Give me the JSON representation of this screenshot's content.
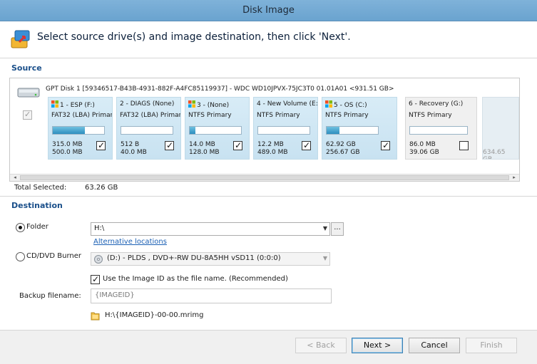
{
  "window": {
    "title": "Disk Image"
  },
  "header": {
    "instruction": "Select source drive(s) and image destination, then click 'Next'."
  },
  "source": {
    "section_label": "Source",
    "disk_info": "GPT Disk 1 [59346517-B43B-4931-882F-A4FC85119937] - WDC WD10JPVX-75JC3T0 01.01A01  <931.51 GB>",
    "partitions": [
      {
        "title": "1 - ESP (F:)",
        "fs": "FAT32 (LBA) Primary",
        "used": "315.0 MB",
        "total": "500.0 MB",
        "fill": 0.63,
        "checked": true,
        "windows_flag": true,
        "style": "selected"
      },
      {
        "title": "2 - DIAGS (None)",
        "fs": "FAT32 (LBA) Primary",
        "used": "512 B",
        "total": "40.0 MB",
        "fill": 0.0,
        "checked": true,
        "windows_flag": false,
        "style": "selected"
      },
      {
        "title": "3 - (None)",
        "fs": "NTFS Primary",
        "used": "14.0 MB",
        "total": "128.0 MB",
        "fill": 0.11,
        "checked": true,
        "windows_flag": true,
        "style": "selected"
      },
      {
        "title": "4 - New Volume (E:)",
        "fs": "NTFS Primary",
        "used": "12.2 MB",
        "total": "489.0 MB",
        "fill": 0.0,
        "checked": true,
        "windows_flag": false,
        "style": "selected"
      },
      {
        "title": "5 - OS (C:)",
        "fs": "NTFS Primary",
        "used": "62.92 GB",
        "total": "256.67 GB",
        "fill": 0.25,
        "checked": true,
        "windows_flag": true,
        "style": "selected"
      },
      {
        "title": "6 - Recovery (G:)",
        "fs": "NTFS Primary",
        "used": "86.0 MB",
        "total": "39.06 GB",
        "fill": 0.0,
        "checked": false,
        "windows_flag": false,
        "style": "plain"
      }
    ],
    "unallocated_size": "634.65 GB",
    "total_selected_label": "Total Selected:",
    "total_selected_value": "63.26 GB"
  },
  "destination": {
    "section_label": "Destination",
    "folder_label": "Folder",
    "folder_value": "H:\\",
    "browse_label": "...",
    "alternative_link": "Alternative locations",
    "cd_label": "CD/DVD Burner",
    "cd_value": "(D:) - PLDS      , DVD+-RW DU-8A5HH vSD11 (0:0:0)",
    "use_image_id_label": "Use the Image ID as the file name.  (Recommended)",
    "backup_filename_label": "Backup filename:",
    "backup_filename_placeholder": "{IMAGEID}",
    "resulting_path": "H:\\{IMAGEID}-00-00.mrimg"
  },
  "footer": {
    "back_label": "< Back",
    "next_label": "Next >",
    "cancel_label": "Cancel",
    "finish_label": "Finish"
  },
  "colors": {
    "title_bar": "#7fb2d9",
    "accent": "#1a4f8a",
    "link": "#1a5fb4",
    "partition_fill": "#2d8fbf"
  }
}
